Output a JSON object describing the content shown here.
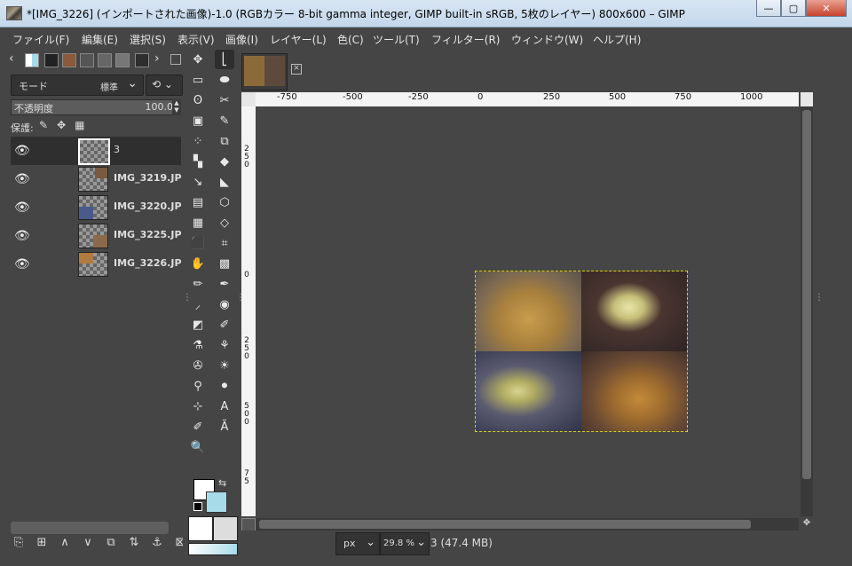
{
  "window": {
    "title": "*[IMG_3226] (インポートされた画像)-1.0 (RGBカラー 8-bit gamma integer, GIMP built-in sRGB, 5枚のレイヤー) 800x600 – GIMP",
    "min_glyph": "—",
    "max_glyph": "▢",
    "close_glyph": "✕"
  },
  "menu": [
    "ファイル(F)",
    "編集(E)",
    "選択(S)",
    "表示(V)",
    "画像(I)",
    "レイヤー(L)",
    "色(C)",
    "ツール(T)",
    "フィルター(R)",
    "ウィンドウ(W)",
    "ヘルプ(H)"
  ],
  "layers_panel": {
    "nav_left": "‹",
    "nav_right": "›",
    "mode_label": "モード",
    "mode_value": "標準",
    "mode_chevron": "⌄",
    "reset_glyph": "⟲ ⌄",
    "opacity_label": "不透明度",
    "opacity_value": "100.0",
    "lock_label": "保護:",
    "lock_icons": [
      "✎",
      "✥",
      "▦"
    ],
    "layers": [
      {
        "name": "3",
        "selected": true
      },
      {
        "name": "IMG_3219.JP",
        "selected": false
      },
      {
        "name": "IMG_3220.JP",
        "selected": false
      },
      {
        "name": "IMG_3225.JP",
        "selected": false
      },
      {
        "name": "IMG_3226.JP",
        "selected": false
      }
    ],
    "bottom_buttons": [
      "⎘",
      "⊞",
      "∧",
      "∨",
      "⧉",
      "⇅",
      "⚓",
      "⊠"
    ]
  },
  "toolbox": {
    "tools": [
      "✥",
      "⎣",
      "▭",
      "⬬",
      "ʘ",
      "✂",
      "▣",
      "✎",
      "⁘",
      "⧉",
      "▚",
      "◆",
      "↘",
      "◣",
      "▤",
      "⬡",
      "▦",
      "◇",
      "⬛",
      "⌗",
      "✋",
      "▩",
      "✏",
      "✒",
      "⸝",
      "◉",
      "◩",
      "✐",
      "⚗",
      "⚘",
      "✇",
      "☀",
      "⚲",
      "⚫",
      "⊹",
      "A",
      "✐",
      "Ã",
      "🔍"
    ],
    "swap_glyph": "⇆"
  },
  "rulers": {
    "top": [
      "-750",
      "-500",
      "-250",
      "0",
      "250",
      "500",
      "750",
      "1000"
    ],
    "left": [
      "2 5 0",
      "0",
      "2 5 0",
      "5 0 0",
      "7 5"
    ]
  },
  "statusbar": {
    "unit": "px",
    "zoom": "29.8 %",
    "chevron": "⌄",
    "text": "3 (47.4 MB)"
  }
}
